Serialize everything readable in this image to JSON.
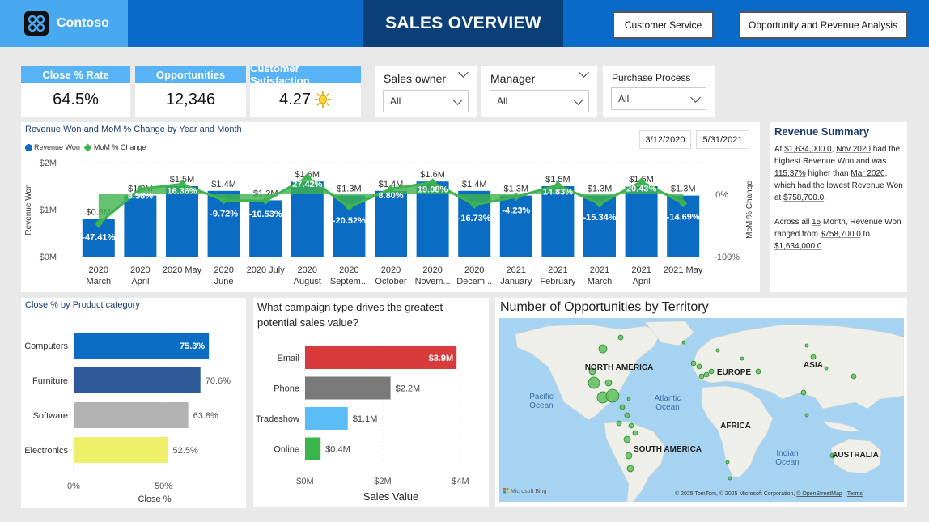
{
  "header": {
    "brand": "Contoso",
    "title": "SALES OVERVIEW",
    "buttons": [
      "Customer Service",
      "Opportunity and Revenue Analysis"
    ]
  },
  "kpis": [
    {
      "label": "Close % Rate",
      "value": "64.5%"
    },
    {
      "label": "Opportunities",
      "value": "12,346"
    },
    {
      "label": "Customer Satisfaction",
      "value": "4.27",
      "icon": "sun-icon"
    }
  ],
  "slicers": [
    {
      "label": "Sales owner",
      "value": "All"
    },
    {
      "label": "Manager",
      "value": "All"
    },
    {
      "label": "Purchase Process",
      "value": "All"
    }
  ],
  "revenue_chart": {
    "title": "Revenue Won and MoM % Change by Year and Month",
    "legend": [
      "Revenue Won",
      "MoM % Change"
    ],
    "date_from": "3/12/2020",
    "date_to": "5/31/2021",
    "y_ticks": [
      "$2M",
      "$1M",
      "$0M"
    ],
    "y2_ticks": [
      "0%",
      "-100%"
    ],
    "ylabel": "Revenue Won",
    "y2label": "MoM % Change"
  },
  "summary": {
    "title": "Revenue Summary",
    "p1": [
      "At ",
      "$1,634,000.0",
      ", ",
      "Nov 2020",
      " had the highest Revenue Won and was ",
      "115.37%",
      " higher than ",
      "Mar 2020",
      ", which had the lowest Revenue Won at ",
      "$758,700.0",
      "."
    ],
    "p2": [
      "Across all ",
      "15",
      " Month, Revenue Won ranged from ",
      "$758,700.0",
      " to ",
      "$1,634,000.0",
      "."
    ]
  },
  "close_chart": {
    "title": "Close % by Product category",
    "xlabel": "Close %",
    "x_ticks": [
      "0%",
      "50%"
    ]
  },
  "campaign_chart": {
    "title": "What campaign type drives the greatest potential sales value?",
    "xlabel": "Sales Value",
    "x_ticks": [
      "$0M",
      "$2M",
      "$4M"
    ]
  },
  "map": {
    "title": "Number of Opportunities by Territory",
    "labels": [
      "NORTH AMERICA",
      "EUROPE",
      "ASIA",
      "Pacific\nOcean",
      "Atlantic\nOcean",
      "AFRICA",
      "SOUTH AMERICA",
      "Indian\nOcean",
      "AUSTRALIA"
    ],
    "attribution": "© 2025 TomTom, © 2025 Microsoft Corporation, ",
    "osm": "© OpenStreetMap",
    "terms": "Terms",
    "bing": "Microsoft Bing"
  },
  "colors": {
    "header": "#0a6ac9",
    "title_bg": "#0a3f78",
    "kpi_head": "#57b3f5",
    "bar_blue": "#0b6cc4",
    "line_green": "#3fb34f"
  },
  "chart_data": [
    {
      "type": "bar",
      "title": "Revenue Won and MoM % Change by Year and Month",
      "categories": [
        "2020 March",
        "2020 April",
        "2020 May",
        "2020 June",
        "2020 July",
        "2020 August",
        "2020 Septem...",
        "2020 October",
        "2020 Novem...",
        "2020 Decem...",
        "2021 January",
        "2021 February",
        "2021 March",
        "2021 April",
        "2021 May"
      ],
      "series": [
        {
          "name": "Revenue Won",
          "values": [
            0.8,
            1.3,
            1.5,
            1.4,
            1.2,
            1.6,
            1.3,
            1.4,
            1.6,
            1.4,
            1.3,
            1.5,
            1.3,
            1.5,
            1.3
          ],
          "labels": [
            "$0.8M",
            "$1.3M",
            "$1.5M",
            "$1.4M",
            "$1.2M",
            "$1.6M",
            "$1.3M",
            "$1.4M",
            "$1.6M",
            "$1.4M",
            "$1.3M",
            "$1.5M",
            "$1.3M",
            "$1.5M",
            "$1.3M"
          ]
        },
        {
          "name": "MoM % Change",
          "values": [
            -47.41,
            8.58,
            16.36,
            -9.72,
            -10.53,
            27.42,
            -20.52,
            8.8,
            19.08,
            -16.73,
            -4.23,
            14.83,
            -15.34,
            20.43,
            -14.69
          ],
          "labels": [
            "-47.41%",
            "8.58%",
            "16.36%",
            "-9.72%",
            "-10.53%",
            "27.42%",
            "-20.52%",
            "8.80%",
            "19.08%",
            "-16.73%",
            "-4.23%",
            "14.83%",
            "-15.34%",
            "20.43%",
            "-14.69%"
          ]
        }
      ],
      "xlabel": "",
      "ylabel": "Revenue Won",
      "y2label": "MoM % Change",
      "ylim": [
        0,
        2
      ],
      "y2lim": [
        -100,
        0
      ]
    },
    {
      "type": "bar",
      "title": "Close % by Product category",
      "categories": [
        "Computers",
        "Furniture",
        "Software",
        "Electronics"
      ],
      "values": [
        75.3,
        70.6,
        63.8,
        52.5
      ],
      "labels": [
        "75.3%",
        "70.6%",
        "63.8%",
        "52.5%"
      ],
      "colors": [
        "#0b6cc4",
        "#2e5a99",
        "#b3b3b3",
        "#eef06a"
      ],
      "xlabel": "Close %",
      "xlim": [
        0,
        90
      ]
    },
    {
      "type": "bar",
      "title": "What campaign type drives the greatest potential sales value?",
      "categories": [
        "Email",
        "Phone",
        "Tradeshow",
        "Online"
      ],
      "values": [
        3.9,
        2.2,
        1.1,
        0.4
      ],
      "labels": [
        "$3.9M",
        "$2.2M",
        "$1.1M",
        "$0.4M"
      ],
      "colors": [
        "#d83b3b",
        "#7a7a7a",
        "#5bbdf7",
        "#3ab54a"
      ],
      "xlabel": "Sales Value",
      "xlim": [
        0,
        4
      ]
    }
  ]
}
